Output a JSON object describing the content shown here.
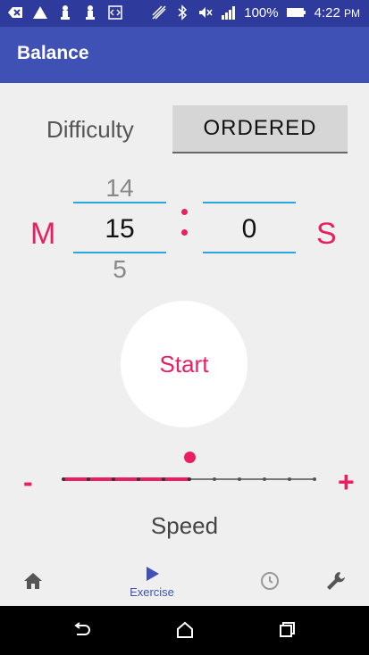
{
  "status_bar": {
    "battery_percent": "100%",
    "time": "4:22",
    "ampm": "PM"
  },
  "app_bar": {
    "title": "Balance"
  },
  "difficulty": {
    "label": "Difficulty",
    "value": "ORDERED"
  },
  "timer": {
    "minutes_label": "M",
    "seconds_label": "S",
    "minutes_prev": "14",
    "minutes_current": "15",
    "minutes_next": "5",
    "seconds_current": "0"
  },
  "start_button": {
    "label": "Start"
  },
  "speed": {
    "label": "Speed",
    "minus": "-",
    "plus": "+",
    "steps": 11,
    "value_index": 5
  },
  "bottom_nav": {
    "items": [
      {
        "icon": "home-icon",
        "label": ""
      },
      {
        "icon": "play-icon",
        "label": "Exercise"
      },
      {
        "icon": "history-icon",
        "label": ""
      },
      {
        "icon": "wrench-icon",
        "label": ""
      }
    ]
  },
  "colors": {
    "primary": "#3f51b5",
    "accent": "#e91e63",
    "divider": "#29a8e0"
  }
}
